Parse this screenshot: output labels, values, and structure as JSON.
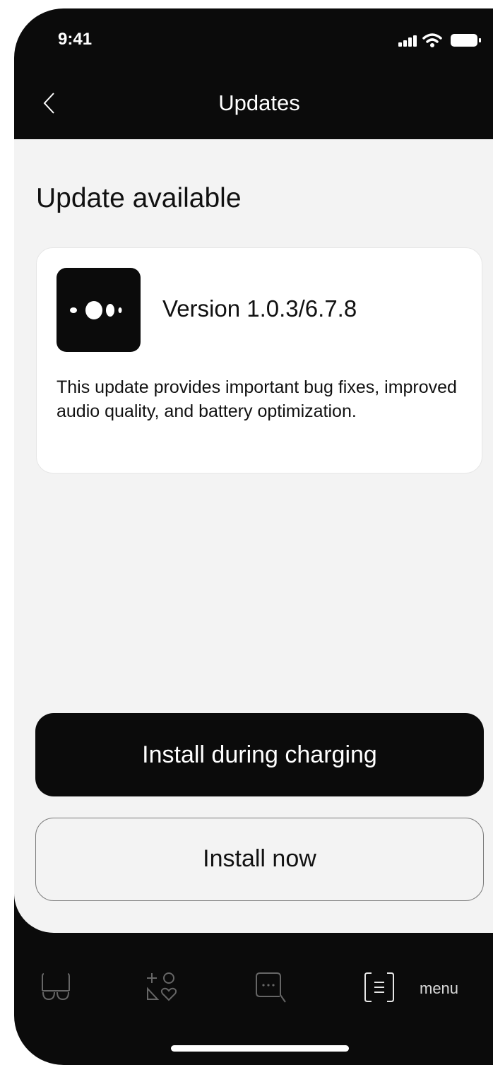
{
  "status_bar": {
    "time": "9:41"
  },
  "nav": {
    "title": "Updates"
  },
  "main": {
    "heading": "Update available",
    "card": {
      "version": "Version 1.0.3/6.7.8",
      "description": "This update provides important bug fixes, improved audio quality, and battery optimization."
    },
    "buttons": {
      "primary": "Install during charging",
      "secondary": "Install now"
    }
  },
  "tabbar": {
    "items": [
      {
        "icon": "glasses-icon"
      },
      {
        "icon": "shapes-icon"
      },
      {
        "icon": "chat-icon"
      },
      {
        "icon": "menu-icon",
        "label": "menu"
      }
    ]
  }
}
